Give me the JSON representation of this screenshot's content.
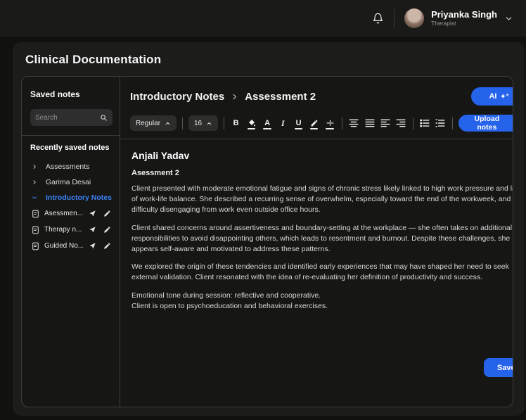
{
  "topbar": {
    "user_name": "Priyanka Singh",
    "user_role": "Therapist"
  },
  "page_title": "Clinical Documentation",
  "sidebar": {
    "title": "Saved notes",
    "search_placeholder": "Search",
    "section_title": "Recently saved notes",
    "groups": [
      {
        "label": "Assessments",
        "expanded": false
      },
      {
        "label": "Garima Desai",
        "expanded": false
      },
      {
        "label": "Introductory Notes",
        "expanded": true
      }
    ],
    "notes": [
      {
        "label": "Asessmen..."
      },
      {
        "label": "Therapy n..."
      },
      {
        "label": "Guided No..."
      }
    ]
  },
  "main": {
    "breadcrumb": {
      "parent": "Introductory Notes",
      "current": "Assessment 2"
    },
    "ai_button_label": "AI",
    "toolbar": {
      "font_style": "Regular",
      "font_size": "16",
      "bold_glyph": "B",
      "italic_glyph": "I",
      "underline_glyph": "U",
      "text_color_glyph": "A",
      "upload_label": "Upload notes"
    },
    "editor": {
      "client_name": "Anjali Yadav",
      "note_title": "Asessment 2",
      "paragraphs": [
        "Client presented with moderate emotional fatigue and signs of chronic stress likely linked to high work pressure and lack of work-life balance. She described a recurring sense of overwhelm, especially toward the end of the workweek, and difficulty disengaging from work even outside office hours.",
        "Client shared concerns around assertiveness and boundary-setting at the workplace — she often takes on additional responsibilities to avoid disappointing others, which leads to resentment and burnout. Despite these challenges, she appears self-aware and motivated to address these patterns.",
        "We explored the origin of these tendencies and identified early experiences that may have shaped her need to seek external validation. Client resonated with the idea of re-evaluating her definition of productivity and success."
      ],
      "closing_lines": [
        "Emotional tone during session: reflective and cooperative.",
        "Client is open to psychoeducation and behavioral exercises."
      ]
    },
    "save_label": "Save"
  },
  "colors": {
    "accent": "#2563eb",
    "active_link": "#3b82f6"
  }
}
